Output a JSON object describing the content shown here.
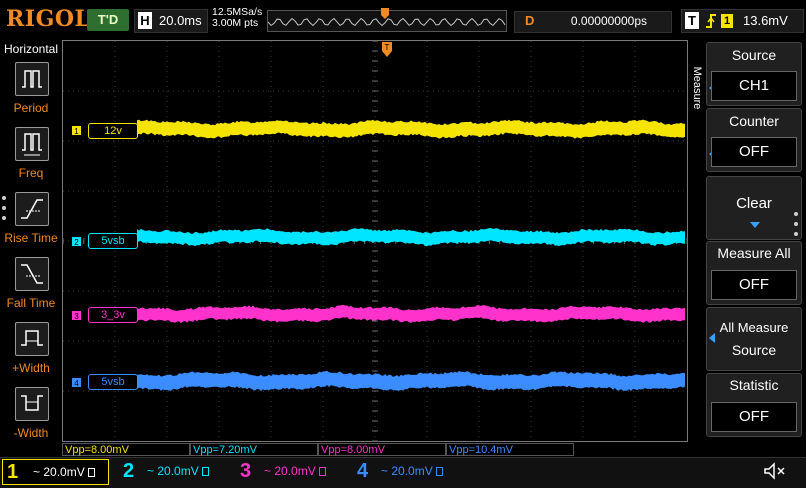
{
  "top": {
    "logo": "RIGOL",
    "run_state": "T'D",
    "timebase_letter": "H",
    "timebase": "20.0ms",
    "sample_rate": "12.5MSa/s",
    "mem_depth": "3.00M pts",
    "delay_letter": "D",
    "delay": "0.00000000ps",
    "trigger_letter": "T",
    "trigger_source": "1",
    "trigger_level": "13.6mV"
  },
  "left_menu": {
    "title": "Horizontal",
    "items": [
      {
        "label": "Period",
        "icon": "period-icon"
      },
      {
        "label": "Freq",
        "icon": "frequency-icon"
      },
      {
        "label": "Rise Time",
        "icon": "rise-time-icon"
      },
      {
        "label": "Fall Time",
        "icon": "fall-time-icon"
      },
      {
        "label": "+Width",
        "icon": "positive-width-icon"
      },
      {
        "label": "-Width",
        "icon": "negative-width-icon"
      }
    ]
  },
  "channels": [
    {
      "num": "1",
      "label": "12v",
      "color": "#f5e300",
      "scale": "20.0mV",
      "measurement": "Vpp=8.00mV"
    },
    {
      "num": "2",
      "label": "5vsb",
      "color": "#00e5ff",
      "scale": "20.0mV",
      "measurement": "Vpp=7.20mV"
    },
    {
      "num": "3",
      "label": "3_3v",
      "color": "#ff33cc",
      "scale": "20.0mV",
      "measurement": "Vpp=8.00mV"
    },
    {
      "num": "4",
      "label": "5vsb",
      "color": "#3a8cff",
      "scale": "20.0mV",
      "measurement": "Vpp=10.4mV"
    }
  ],
  "right_menu": {
    "tab": "Measure",
    "source_title": "Source",
    "source_value": "CH1",
    "counter_title": "Counter",
    "counter_value": "OFF",
    "clear_label": "Clear",
    "measure_all_title": "Measure All",
    "measure_all_value": "OFF",
    "all_measure_title": "All Measure",
    "all_measure_value": "Source",
    "statistic_title": "Statistic",
    "statistic_value": "OFF"
  },
  "colors": {
    "accent": "#f08a24",
    "grid": "#3a3a3a",
    "trigger_marker": "#f08a24"
  }
}
